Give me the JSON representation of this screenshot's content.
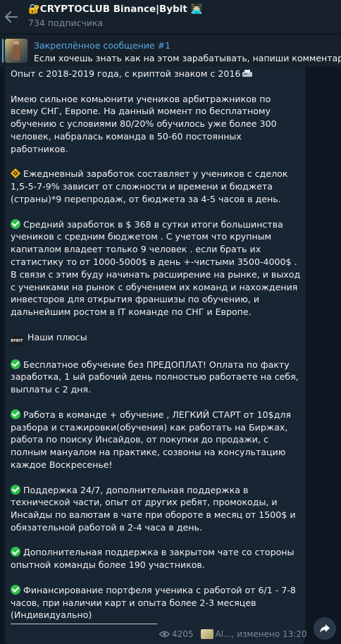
{
  "header": {
    "title": "🔐CRYPTOCLUB Binance|Bybit 👨🏻‍💻",
    "subscribers": "734 подписчика"
  },
  "pinned": {
    "title": "Закреплённое сообщение #1",
    "text": "Если хочешь знать как на этом зарабатывать, напиши комментарий"
  },
  "message": {
    "p1": "Опыт с 2018-2019  года, с криптой знаком с 2016",
    "p2": "Имею сильное комьюнити учеников арбитражников по всему СНГ, Европе. На данный момент по бесплатному обучению с условиями 80/20% обучилось уже более  300 человек, набралась команда в 50-60 постоянных работников.",
    "p3": "Ежедневный заработок составляет у учеников  с сделок 1,5-5-7-9% зависит от сложности и времени и бюджета (страны)*9 перепродаж, от бюджета  за 4-5 часов в день.",
    "p4": "Средний заработок в $  368 в сутки итоги большинства учеников с средним бюджетом . С учетом что крупным капиталом владеет только 9 человек .  если брать их статистику то от 1000-5000$ в день +-чистыми 3500-4000$ .",
    "p4b": "В связи с этим буду начинать расширение на рынке, и выход с учениками на рынок с обучением их команд и нахождения инвесторов для открытия франшизы по обучению, и дальнейшим ростом в IT команде по СНГ и Европе.",
    "plus_heading": "Наши плюсы",
    "bybit_label": "BYBIT",
    "b1": "Бесплатное обучение без ПРЕДОПЛАТ! Оплата по факту заработка, 1 ый рабочий день полностью работаете на себя, выплаты с 2 дня.",
    "b2": "Работа в команде + обучение , ЛЕГКИЙ СТАРТ от 10$для разбора и стажировки(обучения) как работать на Биржах, работа по поиску Инсайдов, от покупки до продажи, с полным мануалом на практике, созвоны на консультацию каждое Воскресенье!",
    "b3": "Поддержка 24/7, дополнительная поддержка в технической части, опыт от других ребят, промокоды, и Инсайды по валютам в чате при обороте в месяц от 1500$ и обязательной работой в 2-4 часа в день.",
    "b4": "Дополнительная поддержка в закрытом чате со стороны опытной команды более 190 участников.",
    "b5": "Финансирование портфеля ученика с работой от 6/1 - 7-8 часов, при наличии карт и опыта более 2-3 месяцев (Индивидуально)"
  },
  "meta": {
    "views": "4205",
    "author": "Al...,",
    "edited": "изменено 13:20"
  },
  "colors": {
    "background": "#0e1621",
    "panel": "#17212b",
    "bubble": "#182533",
    "accent": "#5aa9e6",
    "check": "#2fbf4a"
  },
  "icons": [
    "back-arrow-icon",
    "check-icon",
    "diamond-icon",
    "bybit-logo-icon",
    "eye-icon",
    "share-icon"
  ]
}
